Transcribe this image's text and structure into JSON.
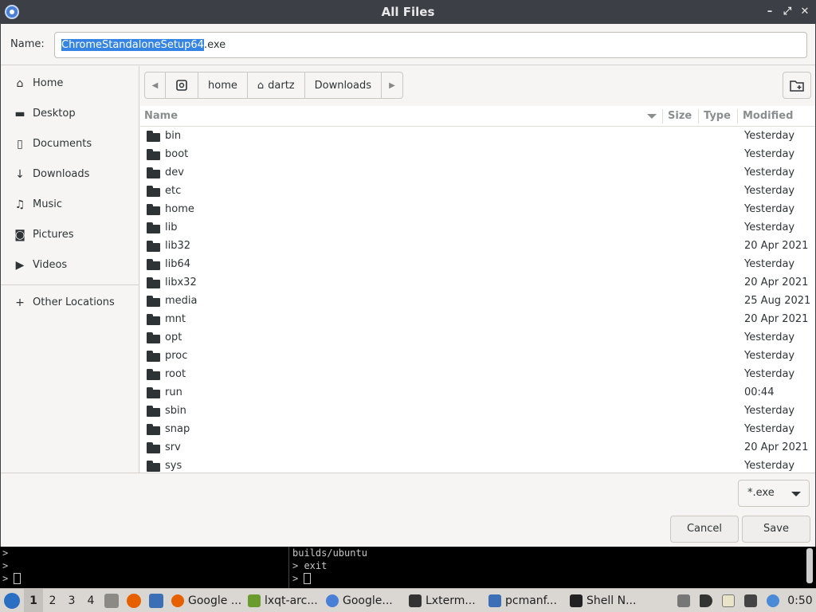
{
  "window": {
    "title": "All Files",
    "minimize_glyph": "–",
    "maximize_glyph": "⤢",
    "close_glyph": "✕"
  },
  "name_bar": {
    "label": "Name:",
    "value_selected": "ChromeStandaloneSetup64",
    "value_rest": ".exe"
  },
  "sidebar": {
    "items": [
      {
        "label": "Home",
        "icon": "home-icon"
      },
      {
        "label": "Desktop",
        "icon": "folder-icon"
      },
      {
        "label": "Documents",
        "icon": "document-icon"
      },
      {
        "label": "Downloads",
        "icon": "download-icon"
      },
      {
        "label": "Music",
        "icon": "music-icon"
      },
      {
        "label": "Pictures",
        "icon": "camera-icon"
      },
      {
        "label": "Videos",
        "icon": "video-icon"
      }
    ],
    "other_locations": {
      "label": "Other Locations",
      "icon": "plus-icon"
    }
  },
  "pathbar": {
    "crumbs": [
      {
        "label": "",
        "icon": "drive-icon"
      },
      {
        "label": "home",
        "icon": ""
      },
      {
        "label": "dartz",
        "icon": "home-icon"
      },
      {
        "label": "Downloads",
        "icon": ""
      }
    ]
  },
  "file_list": {
    "columns": {
      "name": "Name",
      "size": "Size",
      "type": "Type",
      "modified": "Modified"
    },
    "rows": [
      {
        "name": "bin",
        "modified": "Yesterday"
      },
      {
        "name": "boot",
        "modified": "Yesterday"
      },
      {
        "name": "dev",
        "modified": "Yesterday"
      },
      {
        "name": "etc",
        "modified": "Yesterday"
      },
      {
        "name": "home",
        "modified": "Yesterday"
      },
      {
        "name": "lib",
        "modified": "Yesterday"
      },
      {
        "name": "lib32",
        "modified": "20 Apr 2021"
      },
      {
        "name": "lib64",
        "modified": "Yesterday"
      },
      {
        "name": "libx32",
        "modified": "20 Apr 2021"
      },
      {
        "name": "media",
        "modified": "25 Aug 2021"
      },
      {
        "name": "mnt",
        "modified": "20 Apr 2021"
      },
      {
        "name": "opt",
        "modified": "Yesterday"
      },
      {
        "name": "proc",
        "modified": "Yesterday"
      },
      {
        "name": "root",
        "modified": "Yesterday"
      },
      {
        "name": "run",
        "modified": "00:44"
      },
      {
        "name": "sbin",
        "modified": "Yesterday"
      },
      {
        "name": "snap",
        "modified": "Yesterday"
      },
      {
        "name": "srv",
        "modified": "20 Apr 2021"
      },
      {
        "name": "sys",
        "modified": "Yesterday"
      }
    ]
  },
  "filter": {
    "value": "*.exe"
  },
  "buttons": {
    "cancel": "Cancel",
    "save": "Save"
  },
  "terminal": {
    "left_lines": [
      ">",
      ">",
      "> "
    ],
    "right_lines": [
      "builds/ubuntu",
      "> exit",
      "> "
    ]
  },
  "taskbar": {
    "desktops": [
      "1",
      "2",
      "3",
      "4"
    ],
    "active_desktop": "1",
    "tasks": [
      {
        "label": "Google ...",
        "icon": "firefox-icon",
        "color": "#e66000"
      },
      {
        "label": "lxqt-arc...",
        "icon": "archive-icon",
        "color": "#6a9b2d"
      },
      {
        "label": "Google...",
        "icon": "chrome-icon",
        "color": "#4a7fd6"
      },
      {
        "label": "Lxterm...",
        "icon": "terminal-icon",
        "color": "#333333"
      },
      {
        "label": "pcmanf...",
        "icon": "folder-icon",
        "color": "#3d6fb6"
      },
      {
        "label": "Shell N...",
        "icon": "shell-icon",
        "color": "#222222"
      }
    ],
    "clock": "0:50"
  }
}
